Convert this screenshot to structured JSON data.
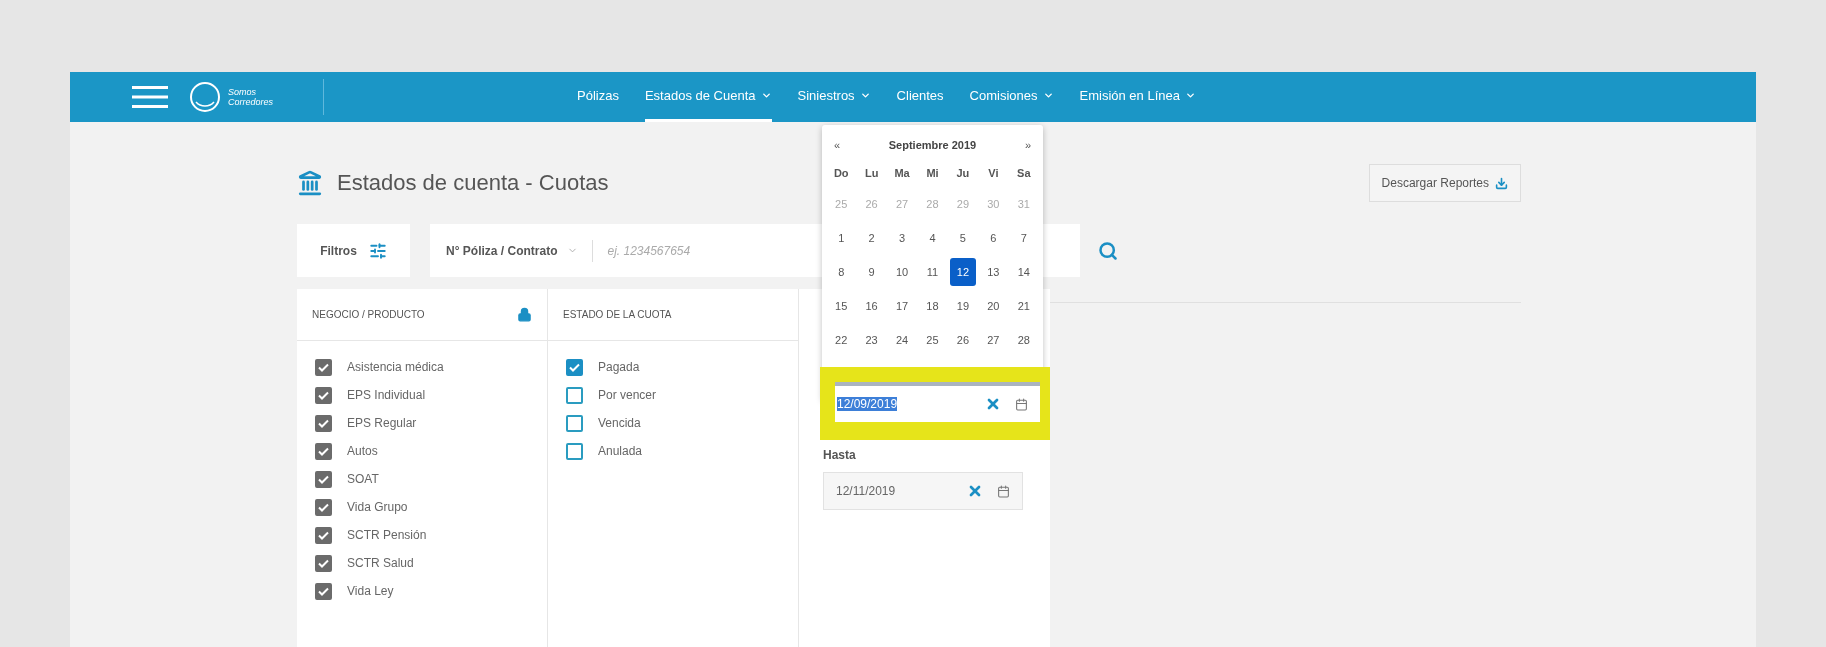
{
  "navbar": {
    "logo": {
      "line1": "Somos",
      "line2": "Corredores"
    },
    "items": [
      {
        "label": "Pólizas",
        "has_caret": false,
        "selected": false
      },
      {
        "label": "Estados de Cuenta",
        "has_caret": true,
        "selected": true
      },
      {
        "label": "Siniestros",
        "has_caret": true,
        "selected": false
      },
      {
        "label": "Clientes",
        "has_caret": false,
        "selected": false
      },
      {
        "label": "Comisiones",
        "has_caret": true,
        "selected": false
      },
      {
        "label": "Emisión en Línea",
        "has_caret": true,
        "selected": false
      }
    ]
  },
  "page_title": "Estados de cuenta - Cuotas",
  "download_button": "Descargar Reportes",
  "filters": {
    "label": "Filtros",
    "search_type": "N° Póliza / Contrato",
    "placeholder": "ej. 1234567654"
  },
  "columns": [
    {
      "title": "NEGOCIO / PRODUCTO",
      "locked": true,
      "options": [
        {
          "label": "Asistencia médica",
          "checked": true
        },
        {
          "label": "EPS Individual",
          "checked": true
        },
        {
          "label": "EPS Regular",
          "checked": true
        },
        {
          "label": "Autos",
          "checked": true
        },
        {
          "label": "SOAT",
          "checked": true
        },
        {
          "label": "Vida Grupo",
          "checked": true
        },
        {
          "label": "SCTR Pensión",
          "checked": true
        },
        {
          "label": "SCTR Salud",
          "checked": true
        },
        {
          "label": "Vida Ley",
          "checked": true
        }
      ]
    },
    {
      "title": "ESTADO DE LA CUOTA",
      "locked": false,
      "options": [
        {
          "label": "Pagada",
          "checked": true
        },
        {
          "label": "Por vencer",
          "checked": false
        },
        {
          "label": "Vencida",
          "checked": false
        },
        {
          "label": "Anulada",
          "checked": false
        }
      ]
    }
  ],
  "date_from": {
    "value": "12/09/2019",
    "text_selected": true
  },
  "date_to": {
    "label": "Hasta",
    "value": "12/11/2019"
  },
  "calendar": {
    "prev": "«",
    "month": "Septiembre 2019",
    "next": "»",
    "weekdays": [
      "Do",
      "Lu",
      "Ma",
      "Mi",
      "Ju",
      "Vi",
      "Sa"
    ],
    "weeks": [
      [
        {
          "day": "25",
          "muted": true,
          "selected": false
        },
        {
          "day": "26",
          "muted": true,
          "selected": false
        },
        {
          "day": "27",
          "muted": true,
          "selected": false
        },
        {
          "day": "28",
          "muted": true,
          "selected": false
        },
        {
          "day": "29",
          "muted": true,
          "selected": false
        },
        {
          "day": "30",
          "muted": true,
          "selected": false
        },
        {
          "day": "31",
          "muted": true,
          "selected": false
        }
      ],
      [
        {
          "day": "1",
          "muted": false,
          "selected": false
        },
        {
          "day": "2",
          "muted": false,
          "selected": false
        },
        {
          "day": "3",
          "muted": false,
          "selected": false
        },
        {
          "day": "4",
          "muted": false,
          "selected": false
        },
        {
          "day": "5",
          "muted": false,
          "selected": false
        },
        {
          "day": "6",
          "muted": false,
          "selected": false
        },
        {
          "day": "7",
          "muted": false,
          "selected": false
        }
      ],
      [
        {
          "day": "8",
          "muted": false,
          "selected": false
        },
        {
          "day": "9",
          "muted": false,
          "selected": false
        },
        {
          "day": "10",
          "muted": false,
          "selected": false
        },
        {
          "day": "11",
          "muted": false,
          "selected": false
        },
        {
          "day": "12",
          "muted": false,
          "selected": true
        },
        {
          "day": "13",
          "muted": false,
          "selected": false
        },
        {
          "day": "14",
          "muted": false,
          "selected": false
        }
      ],
      [
        {
          "day": "15",
          "muted": false,
          "selected": false
        },
        {
          "day": "16",
          "muted": false,
          "selected": false
        },
        {
          "day": "17",
          "muted": false,
          "selected": false
        },
        {
          "day": "18",
          "muted": false,
          "selected": false
        },
        {
          "day": "19",
          "muted": false,
          "selected": false
        },
        {
          "day": "20",
          "muted": false,
          "selected": false
        },
        {
          "day": "21",
          "muted": false,
          "selected": false
        }
      ],
      [
        {
          "day": "22",
          "muted": false,
          "selected": false
        },
        {
          "day": "23",
          "muted": false,
          "selected": false
        },
        {
          "day": "24",
          "muted": false,
          "selected": false
        },
        {
          "day": "25",
          "muted": false,
          "selected": false
        },
        {
          "day": "26",
          "muted": false,
          "selected": false
        },
        {
          "day": "27",
          "muted": false,
          "selected": false
        },
        {
          "day": "28",
          "muted": false,
          "selected": false
        }
      ]
    ]
  }
}
